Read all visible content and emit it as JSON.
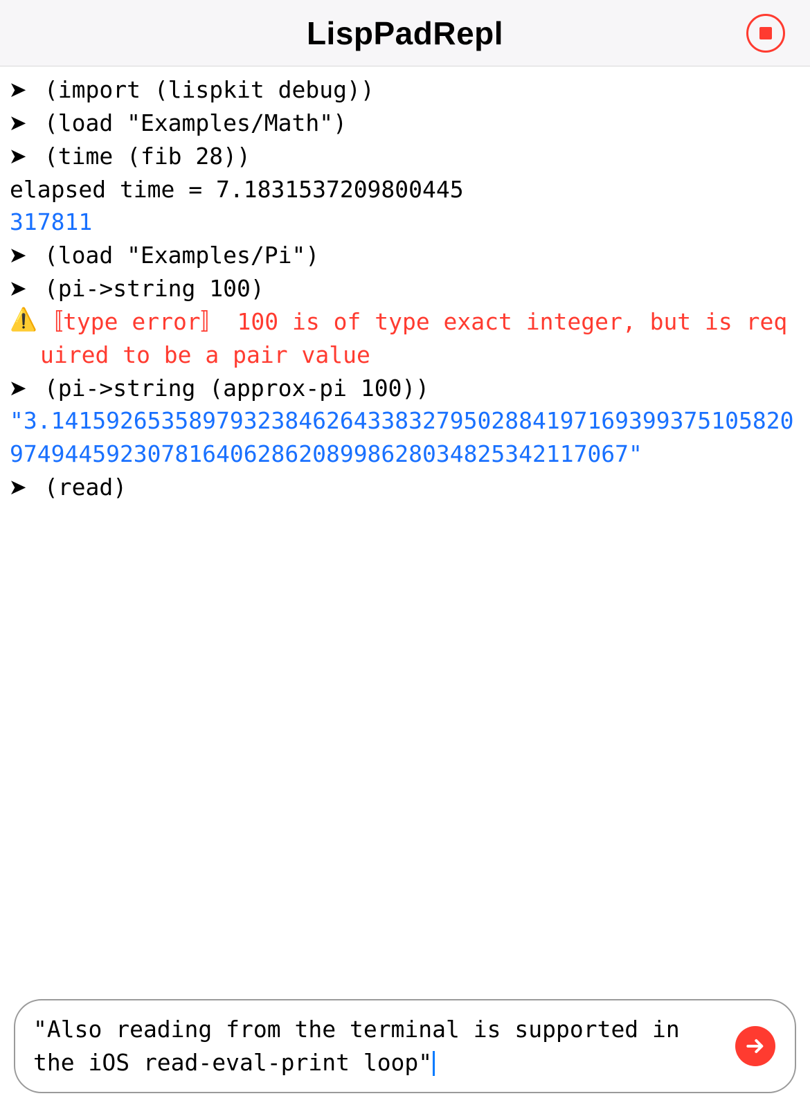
{
  "header": {
    "title": "LispPadRepl"
  },
  "repl": {
    "lines": [
      {
        "type": "prompt",
        "text": "(import (lispkit debug))"
      },
      {
        "type": "prompt",
        "text": "(load \"Examples/Math\")"
      },
      {
        "type": "prompt",
        "text": "(time (fib 28))"
      },
      {
        "type": "stdout",
        "text": "elapsed time = 7.1831537209800445"
      },
      {
        "type": "result",
        "text": "317811"
      },
      {
        "type": "prompt",
        "text": "(load \"Examples/Pi\")"
      },
      {
        "type": "prompt",
        "text": "(pi->string 100)"
      },
      {
        "type": "error",
        "text": "〚type error〛 100 is of type exact integer, but is required to be a pair value"
      },
      {
        "type": "prompt",
        "text": "(pi->string (approx-pi 100))"
      },
      {
        "type": "result",
        "text": "\"3.141592653589793238462643383279502884197169399375105820974944592307816406286208998628034825342117067\""
      },
      {
        "type": "prompt",
        "text": "(read)"
      }
    ]
  },
  "input": {
    "value": "\"Also reading from the terminal is supported in the iOS read-eval-print loop\""
  },
  "icons": {
    "stop": "stop-icon",
    "warn": "warning-icon",
    "send": "arrow-right-icon"
  }
}
